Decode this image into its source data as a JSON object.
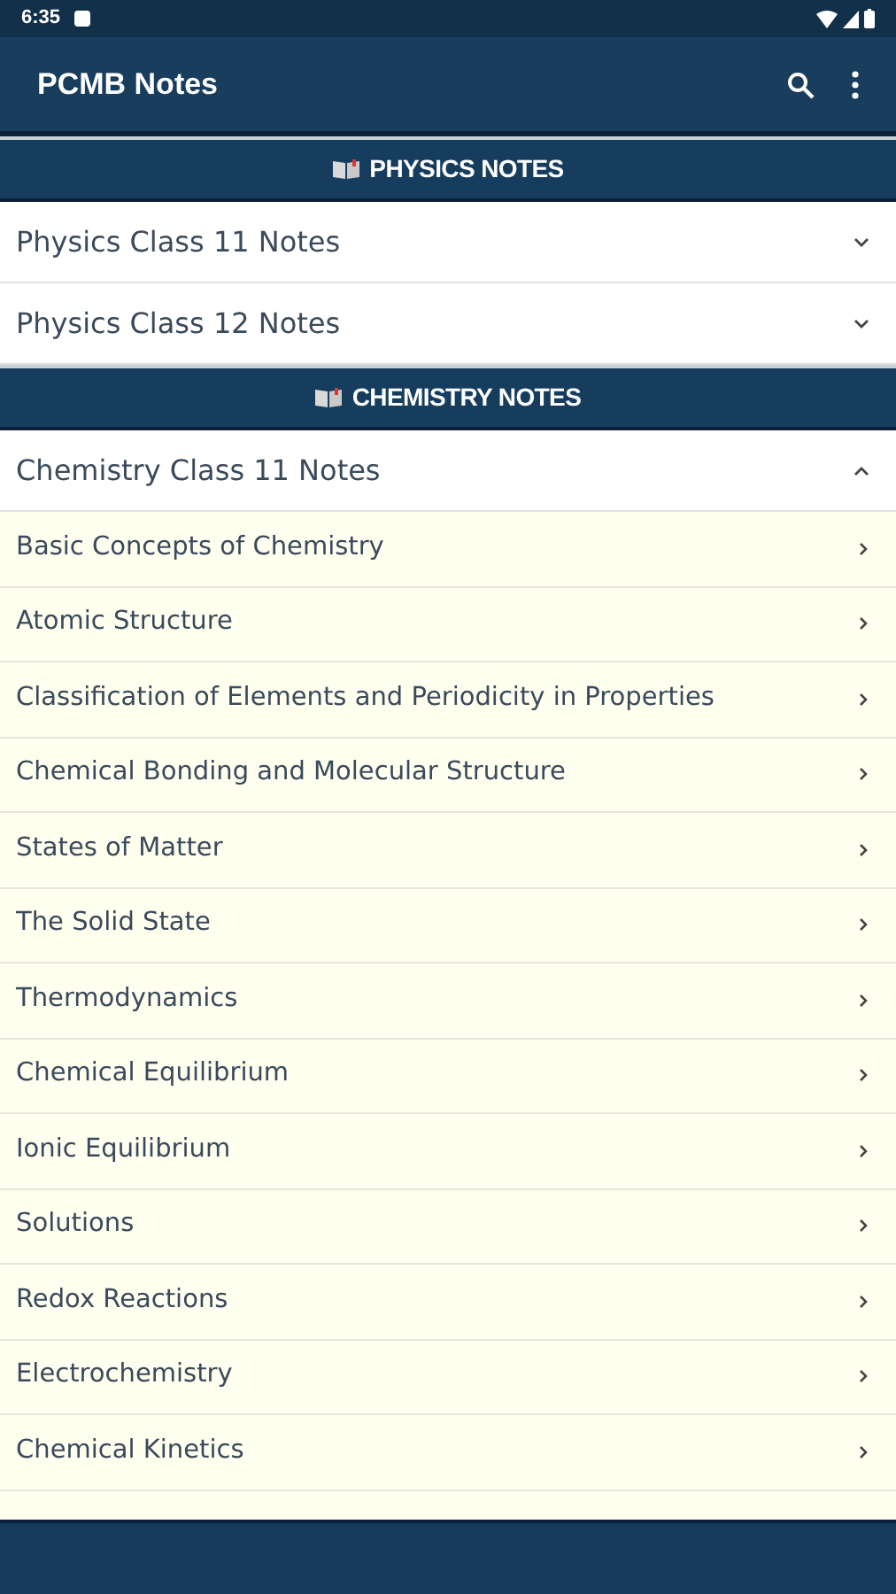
{
  "status_bar": {
    "time": "6:35"
  },
  "app_bar": {
    "title": "PCMB Notes"
  },
  "sections": [
    {
      "title": "PHYSICS NOTES",
      "groups": [
        {
          "title": "Physics Class 11 Notes",
          "expanded": false
        },
        {
          "title": "Physics Class 12 Notes",
          "expanded": false
        }
      ]
    },
    {
      "title": "CHEMISTRY NOTES",
      "groups": [
        {
          "title": "Chemistry Class 11 Notes",
          "expanded": true,
          "chapters": [
            "Basic Concepts of Chemistry",
            "Atomic Structure",
            "Classification of Elements and Periodicity in Properties",
            "Chemical Bonding and Molecular Structure",
            "States of Matter",
            "The Solid State",
            "Thermodynamics",
            "Chemical Equilibrium",
            "Ionic Equilibrium",
            "Solutions",
            "Redox Reactions",
            "Electrochemistry",
            "Chemical Kinetics"
          ]
        }
      ]
    }
  ]
}
